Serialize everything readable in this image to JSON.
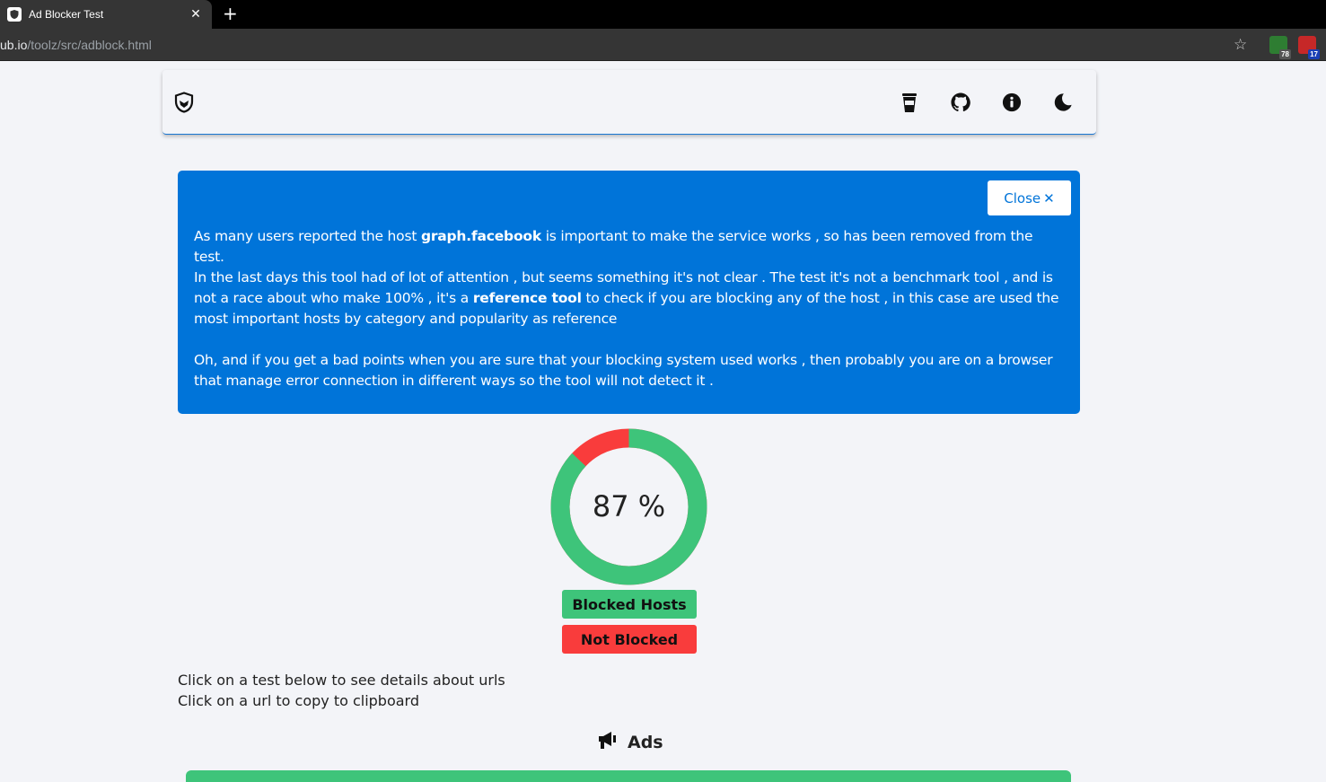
{
  "browser": {
    "tab_title": "Ad Blocker Test",
    "tab_close": "✕",
    "new_tab": "+",
    "url_host": "ub.io",
    "url_path": "/toolz/src/adblock.html",
    "ext1_badge": "78",
    "ext2_badge": "17"
  },
  "navbar": {
    "icons": [
      "shield-logo-icon",
      "coffee-cup-icon",
      "github-icon",
      "info-icon",
      "moon-icon"
    ]
  },
  "notice": {
    "close_label": "Close",
    "close_glyph": "✕",
    "p1_before": "As many users reported the host ",
    "p1_bold": "graph.facebook",
    "p1_after": " is important to make the service works , so has been removed from the test.",
    "p2_before": "In the last days this tool had of lot of attention , but seems something it's not clear . The test it's not a benchmark tool , and is not a race about who make 100% , it's a ",
    "p2_bold": "reference tool",
    "p2_after": " to check if you are blocking any of the host , in this case are used the most important hosts by category and popularity as reference",
    "p3": "Oh, and if you get a bad points when you are sure that your blocking system used works , then probably you are on a browser that manage error connection in different ways so the tool will not detect it ."
  },
  "result": {
    "percent_label": "87 %",
    "blocked_fraction": 0.87,
    "blocked_color": "#3ec47a",
    "not_blocked_color": "#f93c3c",
    "legend_blocked": "Blocked Hosts",
    "legend_not_blocked": "Not Blocked"
  },
  "hints": {
    "line1": "Click on a test below to see details about urls",
    "line2": "Click on a url to copy to clipboard"
  },
  "section": {
    "title": "Ads",
    "icon": "megaphone-icon"
  }
}
